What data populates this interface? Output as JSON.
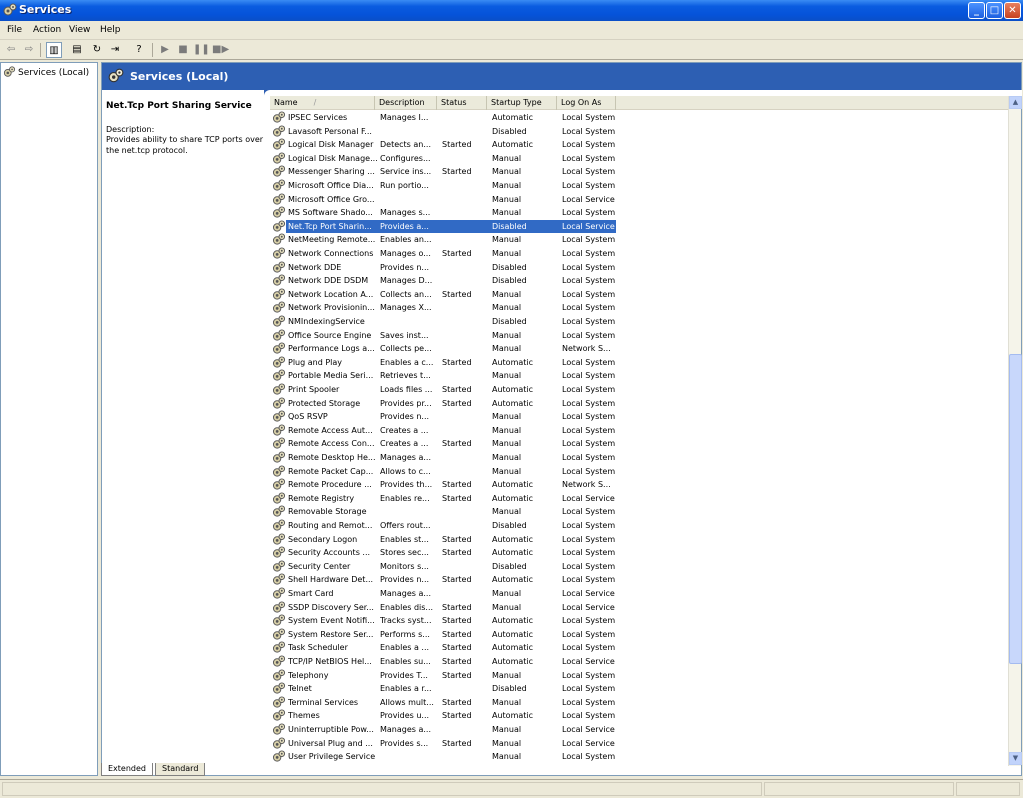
{
  "window": {
    "title": "Services"
  },
  "menu": [
    "File",
    "Action",
    "View",
    "Help"
  ],
  "tree": {
    "root": "Services (Local)"
  },
  "banner": {
    "title": "Services (Local)"
  },
  "description": {
    "name": "Net.Tcp Port Sharing Service",
    "label": "Description:",
    "text": "Provides ability to share TCP ports over the net.tcp protocol."
  },
  "columns": [
    "Name",
    "Description",
    "Status",
    "Startup Type",
    "Log On As"
  ],
  "rows": [
    [
      "IPSEC Services",
      "Manages I...",
      "",
      "Automatic",
      "Local System"
    ],
    [
      "Lavasoft Personal F...",
      "",
      "",
      "Disabled",
      "Local System"
    ],
    [
      "Logical Disk Manager",
      "Detects an...",
      "Started",
      "Automatic",
      "Local System"
    ],
    [
      "Logical Disk Manage...",
      "Configures...",
      "",
      "Manual",
      "Local System"
    ],
    [
      "Messenger Sharing ...",
      "Service ins...",
      "Started",
      "Manual",
      "Local System"
    ],
    [
      "Microsoft Office Dia...",
      "Run portio...",
      "",
      "Manual",
      "Local System"
    ],
    [
      "Microsoft Office Gro...",
      "",
      "",
      "Manual",
      "Local Service"
    ],
    [
      "MS Software Shado...",
      "Manages s...",
      "",
      "Manual",
      "Local System"
    ],
    [
      "Net.Tcp Port Sharin...",
      "Provides a...",
      "",
      "Disabled",
      "Local Service"
    ],
    [
      "NetMeeting Remote...",
      "Enables an...",
      "",
      "Manual",
      "Local System"
    ],
    [
      "Network Connections",
      "Manages o...",
      "Started",
      "Manual",
      "Local System"
    ],
    [
      "Network DDE",
      "Provides n...",
      "",
      "Disabled",
      "Local System"
    ],
    [
      "Network DDE DSDM",
      "Manages D...",
      "",
      "Disabled",
      "Local System"
    ],
    [
      "Network Location A...",
      "Collects an...",
      "Started",
      "Manual",
      "Local System"
    ],
    [
      "Network Provisionin...",
      "Manages X...",
      "",
      "Manual",
      "Local System"
    ],
    [
      "NMIndexingService",
      "",
      "",
      "Disabled",
      "Local System"
    ],
    [
      "Office Source Engine",
      "Saves inst...",
      "",
      "Manual",
      "Local System"
    ],
    [
      "Performance Logs a...",
      "Collects pe...",
      "",
      "Manual",
      "Network S..."
    ],
    [
      "Plug and Play",
      "Enables a c...",
      "Started",
      "Automatic",
      "Local System"
    ],
    [
      "Portable Media Seri...",
      "Retrieves t...",
      "",
      "Manual",
      "Local System"
    ],
    [
      "Print Spooler",
      "Loads files ...",
      "Started",
      "Automatic",
      "Local System"
    ],
    [
      "Protected Storage",
      "Provides pr...",
      "Started",
      "Automatic",
      "Local System"
    ],
    [
      "QoS RSVP",
      "Provides n...",
      "",
      "Manual",
      "Local System"
    ],
    [
      "Remote Access Aut...",
      "Creates a ...",
      "",
      "Manual",
      "Local System"
    ],
    [
      "Remote Access Con...",
      "Creates a ...",
      "Started",
      "Manual",
      "Local System"
    ],
    [
      "Remote Desktop He...",
      "Manages a...",
      "",
      "Manual",
      "Local System"
    ],
    [
      "Remote Packet Cap...",
      "Allows to c...",
      "",
      "Manual",
      "Local System"
    ],
    [
      "Remote Procedure ...",
      "Provides th...",
      "Started",
      "Automatic",
      "Network S..."
    ],
    [
      "Remote Registry",
      "Enables re...",
      "Started",
      "Automatic",
      "Local Service"
    ],
    [
      "Removable Storage",
      "",
      "",
      "Manual",
      "Local System"
    ],
    [
      "Routing and Remot...",
      "Offers rout...",
      "",
      "Disabled",
      "Local System"
    ],
    [
      "Secondary Logon",
      "Enables st...",
      "Started",
      "Automatic",
      "Local System"
    ],
    [
      "Security Accounts ...",
      "Stores sec...",
      "Started",
      "Automatic",
      "Local System"
    ],
    [
      "Security Center",
      "Monitors s...",
      "",
      "Disabled",
      "Local System"
    ],
    [
      "Shell Hardware Det...",
      "Provides n...",
      "Started",
      "Automatic",
      "Local System"
    ],
    [
      "Smart Card",
      "Manages a...",
      "",
      "Manual",
      "Local Service"
    ],
    [
      "SSDP Discovery Ser...",
      "Enables dis...",
      "Started",
      "Manual",
      "Local Service"
    ],
    [
      "System Event Notifi...",
      "Tracks syst...",
      "Started",
      "Automatic",
      "Local System"
    ],
    [
      "System Restore Ser...",
      "Performs s...",
      "Started",
      "Automatic",
      "Local System"
    ],
    [
      "Task Scheduler",
      "Enables a ...",
      "Started",
      "Automatic",
      "Local System"
    ],
    [
      "TCP/IP NetBIOS Hel...",
      "Enables su...",
      "Started",
      "Automatic",
      "Local Service"
    ],
    [
      "Telephony",
      "Provides T...",
      "Started",
      "Manual",
      "Local System"
    ],
    [
      "Telnet",
      "Enables a r...",
      "",
      "Disabled",
      "Local System"
    ],
    [
      "Terminal Services",
      "Allows mult...",
      "Started",
      "Manual",
      "Local System"
    ],
    [
      "Themes",
      "Provides u...",
      "Started",
      "Automatic",
      "Local System"
    ],
    [
      "Uninterruptible Pow...",
      "Manages a...",
      "",
      "Manual",
      "Local Service"
    ],
    [
      "Universal Plug and ...",
      "Provides s...",
      "Started",
      "Manual",
      "Local Service"
    ],
    [
      "User Privilege Service",
      "",
      "",
      "Manual",
      "Local System"
    ]
  ],
  "selected_row": 8,
  "tabs": [
    "Extended",
    "Standard"
  ],
  "active_tab": 0,
  "colors": {
    "selection": "#316ac5",
    "banner": "#2d5fb3"
  }
}
